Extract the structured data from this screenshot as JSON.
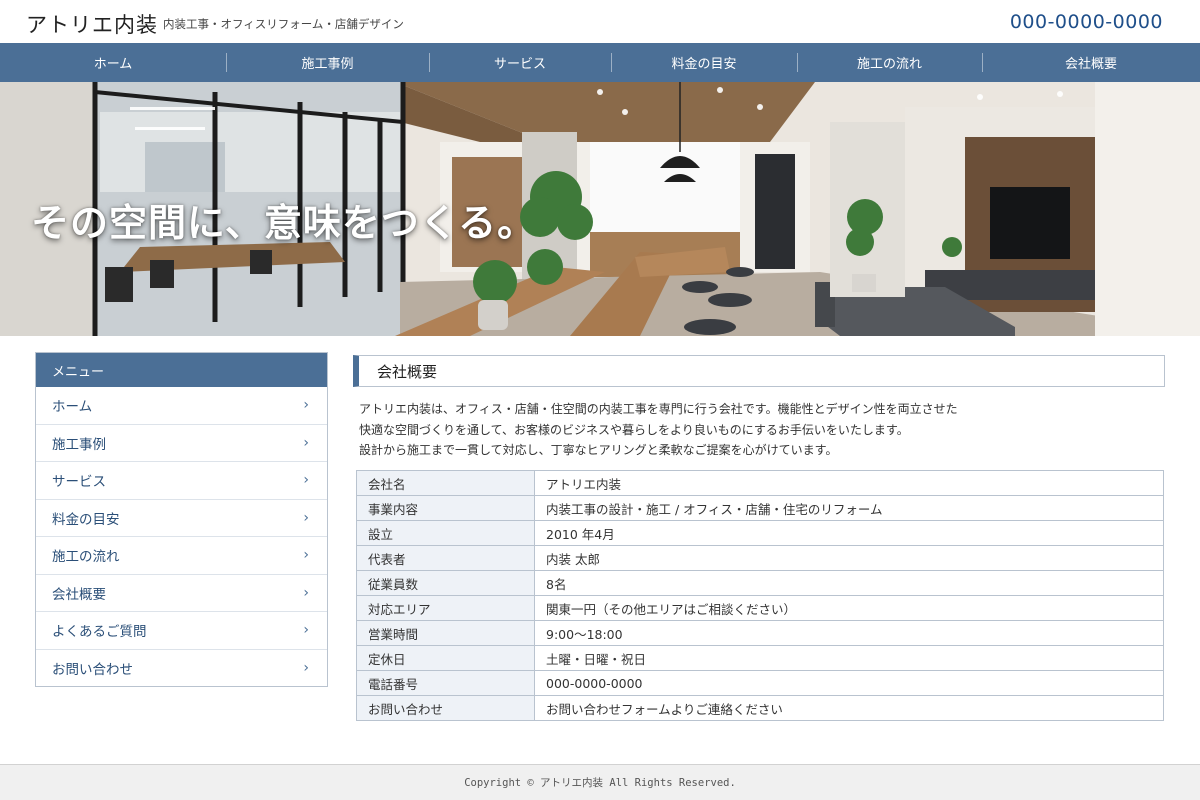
{
  "header": {
    "logo": "アトリエ内装",
    "tagline": "内装工事・オフィスリフォーム・店舗デザイン",
    "phone": "000-0000-0000"
  },
  "nav": {
    "items": [
      {
        "label": "ホーム"
      },
      {
        "label": "施工事例"
      },
      {
        "label": "サービス"
      },
      {
        "label": "料金の目安"
      },
      {
        "label": "施工の流れ"
      },
      {
        "label": "会社概要"
      }
    ]
  },
  "hero": {
    "copy": "その空間に、意味をつくる。"
  },
  "sidebar": {
    "heading": "メニュー",
    "chevron": "›",
    "items": [
      {
        "label": "ホーム"
      },
      {
        "label": "施工事例"
      },
      {
        "label": "サービス"
      },
      {
        "label": "料金の目安"
      },
      {
        "label": "施工の流れ"
      },
      {
        "label": "会社概要"
      },
      {
        "label": "よくあるご質問"
      },
      {
        "label": "お問い合わせ"
      }
    ]
  },
  "main": {
    "title": "会社概要",
    "intro": [
      "アトリエ内装は、オフィス・店舗・住空間の内装工事を専門に行う会社です。機能性とデザイン性を両立させた",
      "快適な空間づくりを通して、お客様のビジネスや暮らしをより良いものにするお手伝いをいたします。",
      "設計から施工まで一貫して対応し、丁寧なヒアリングと柔軟なご提案を心がけています。"
    ],
    "table": [
      {
        "key": "会社名",
        "value": "アトリエ内装"
      },
      {
        "key": "事業内容",
        "value": "内装工事の設計・施工 / オフィス・店舗・住宅のリフォーム"
      },
      {
        "key": "設立",
        "value": "2010 年4月"
      },
      {
        "key": "代表者",
        "value": "内装 太郎"
      },
      {
        "key": "従業員数",
        "value": "8名"
      },
      {
        "key": "対応エリア",
        "value": "関東一円（その他エリアはご相談ください）"
      },
      {
        "key": "営業時間",
        "value": "9:00〜18:00"
      },
      {
        "key": "定休日",
        "value": "土曜・日曜・祝日"
      },
      {
        "key": "電話番号",
        "value": "000-0000-0000"
      },
      {
        "key": "お問い合わせ",
        "value": "お問い合わせフォームよりご連絡ください"
      }
    ]
  },
  "footer": {
    "copyright": "Copyright © アトリエ内装 All Rights Reserved."
  },
  "colors": {
    "primary": "#4b6f96",
    "phone": "#1f4f8a",
    "table_key_bg": "#eef2f7",
    "border": "#b9c3cf"
  }
}
